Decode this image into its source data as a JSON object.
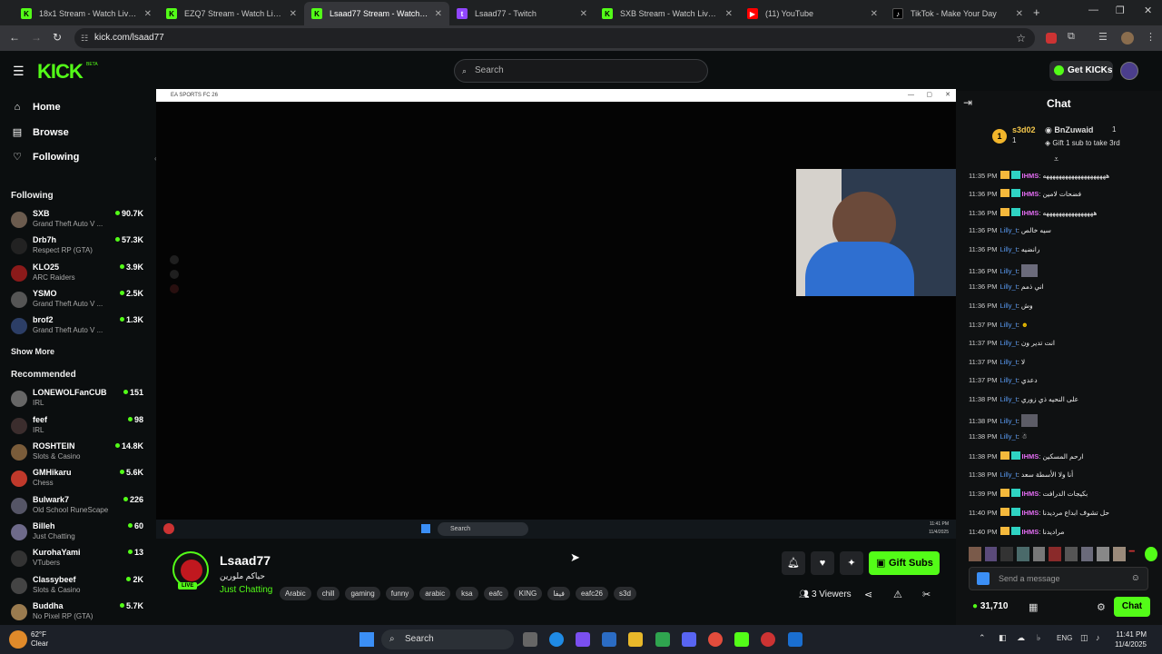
{
  "browser": {
    "tabs": [
      {
        "title": "18x1 Stream - Watch Live on Kick",
        "active": false,
        "favicon": "kick-icon"
      },
      {
        "title": "EZQ7 Stream - Watch Live on Kick",
        "active": false,
        "favicon": "kick-icon"
      },
      {
        "title": "Lsaad77 Stream - Watch Live on Kick",
        "active": true,
        "favicon": "kick-icon"
      },
      {
        "title": "Lsaad77 - Twitch",
        "active": false,
        "favicon": "twitch-icon"
      },
      {
        "title": "SXB Stream - Watch Live on Kick",
        "active": false,
        "favicon": "kick-icon"
      },
      {
        "title": "(11) YouTube",
        "active": false,
        "favicon": "youtube-icon"
      },
      {
        "title": "TikTok - Make Your Day",
        "active": false,
        "favicon": "tiktok-icon"
      }
    ],
    "url": "kick.com/lsaad77"
  },
  "header": {
    "logo": "KICK",
    "logo_badge": "BETA",
    "search_placeholder": "Search",
    "get_kicks": "Get KICKs"
  },
  "sidebar": {
    "nav": [
      {
        "label": "Home",
        "icon": "home-icon"
      },
      {
        "label": "Browse",
        "icon": "browse-icon"
      },
      {
        "label": "Following",
        "icon": "heart-icon"
      }
    ],
    "following_heading": "Following",
    "following": [
      {
        "name": "SXB",
        "category": "Grand Theft Auto V ...",
        "viewers": "90.7K"
      },
      {
        "name": "Drb7h",
        "category": "Respect RP (GTA)",
        "viewers": "57.3K"
      },
      {
        "name": "KLO25",
        "category": "ARC Raiders",
        "viewers": "3.9K"
      },
      {
        "name": "YSMO",
        "category": "Grand Theft Auto V ...",
        "viewers": "2.5K"
      },
      {
        "name": "brof2",
        "category": "Grand Theft Auto V ...",
        "viewers": "1.3K"
      }
    ],
    "show_more": "Show More",
    "recommended_heading": "Recommended",
    "recommended": [
      {
        "name": "LONEWOLFanCUB",
        "category": "IRL",
        "viewers": "151"
      },
      {
        "name": "feef",
        "category": "IRL",
        "viewers": "98"
      },
      {
        "name": "ROSHTEIN",
        "category": "Slots & Casino",
        "viewers": "14.8K"
      },
      {
        "name": "GMHikaru",
        "category": "Chess",
        "viewers": "5.6K"
      },
      {
        "name": "Bulwark7",
        "category": "Old School RuneScape",
        "viewers": "226"
      },
      {
        "name": "Billeh",
        "category": "Just Chatting",
        "viewers": "60"
      },
      {
        "name": "KurohaYami",
        "category": "VTubers",
        "viewers": "13"
      },
      {
        "name": "Classybeef",
        "category": "Slots & Casino",
        "viewers": "2K"
      },
      {
        "name": "Buddha",
        "category": "No Pixel RP (GTA)",
        "viewers": "5.7K"
      }
    ]
  },
  "player": {
    "window_title": "EA SPORTS FC 26",
    "inner_taskbar_search": "Search",
    "inner_time": "11:41 PM",
    "inner_date": "11/4/2025"
  },
  "stream": {
    "streamer": "Lsaad77",
    "title": "حياكم ملورين",
    "category": "Just Chatting",
    "tags": [
      "Arabic",
      "chill",
      "gaming",
      "funny",
      "arabic",
      "ksa",
      "eafc",
      "KING",
      "فيفا",
      "eafc26",
      "s3d"
    ],
    "live_badge": "LIVE",
    "gift_subs": "Gift Subs",
    "viewers": "3 Viewers"
  },
  "chat": {
    "title": "Chat",
    "pinned_user1": "s3d02",
    "pinned_user1_count": "1",
    "pinned_user2": "BnZuwaid",
    "pinned_user2_count": "1",
    "pinned_note": "Gift 1 sub to take 3rd",
    "messages": [
      {
        "time": "11:35 PM",
        "user": "IHMS",
        "text": "ههههههههههههههههههههه",
        "style": "u1"
      },
      {
        "time": "11:36 PM",
        "user": "IHMS",
        "text": "فضحات لامين",
        "style": "u1"
      },
      {
        "time": "11:36 PM",
        "user": "IHMS",
        "text": "ههههههههههههههههه",
        "style": "u1"
      },
      {
        "time": "11:36 PM",
        "user": "Lilly_t",
        "text": "سيه خالص",
        "style": "u2"
      },
      {
        "time": "11:36 PM",
        "user": "Lilly_t",
        "text": "رانضيه",
        "style": "u2"
      },
      {
        "time": "11:36 PM",
        "user": "Lilly_t",
        "text": "",
        "style": "u2"
      },
      {
        "time": "11:36 PM",
        "user": "Lilly_t",
        "text": "اني ذمم",
        "style": "u2"
      },
      {
        "time": "11:36 PM",
        "user": "Lilly_t",
        "text": "وش",
        "style": "u2"
      },
      {
        "time": "11:37 PM",
        "user": "Lilly_t",
        "text": "",
        "style": "u2"
      },
      {
        "time": "11:37 PM",
        "user": "Lilly_t",
        "text": "انت تدير ون",
        "style": "u2"
      },
      {
        "time": "11:37 PM",
        "user": "Lilly_t",
        "text": "لا",
        "style": "u2"
      },
      {
        "time": "11:37 PM",
        "user": "Lilly_t",
        "text": "دعدي",
        "style": "u2"
      },
      {
        "time": "11:38 PM",
        "user": "Lilly_t",
        "text": "على النحيه ذي زوري",
        "style": "u2"
      },
      {
        "time": "11:38 PM",
        "user": "Lilly_t",
        "text": "",
        "style": "u2"
      },
      {
        "time": "11:38 PM",
        "user": "Lilly_t",
        "text": "",
        "style": "u2"
      },
      {
        "time": "11:38 PM",
        "user": "IHMS",
        "text": "ارحم المسكين",
        "style": "u1"
      },
      {
        "time": "11:38 PM",
        "user": "Lilly_t",
        "text": "أنا ولا الأسطة سعد",
        "style": "u2"
      },
      {
        "time": "11:39 PM",
        "user": "IHMS",
        "text": "بكيجات الدرافت",
        "style": "u1"
      },
      {
        "time": "11:40 PM",
        "user": "IHMS",
        "text": "حل تشوف ابداع مرديدنا",
        "style": "u1"
      },
      {
        "time": "11:40 PM",
        "user": "IHMS",
        "text": "مراديدنا",
        "style": "u1"
      }
    ],
    "input_placeholder": "Send a message",
    "kicks_count": "31,710",
    "send_label": "Chat"
  },
  "taskbar": {
    "weather_temp": "62°F",
    "weather_desc": "Clear",
    "search": "Search",
    "lang": "ENG",
    "time": "11:41 PM",
    "date": "11/4/2025"
  }
}
